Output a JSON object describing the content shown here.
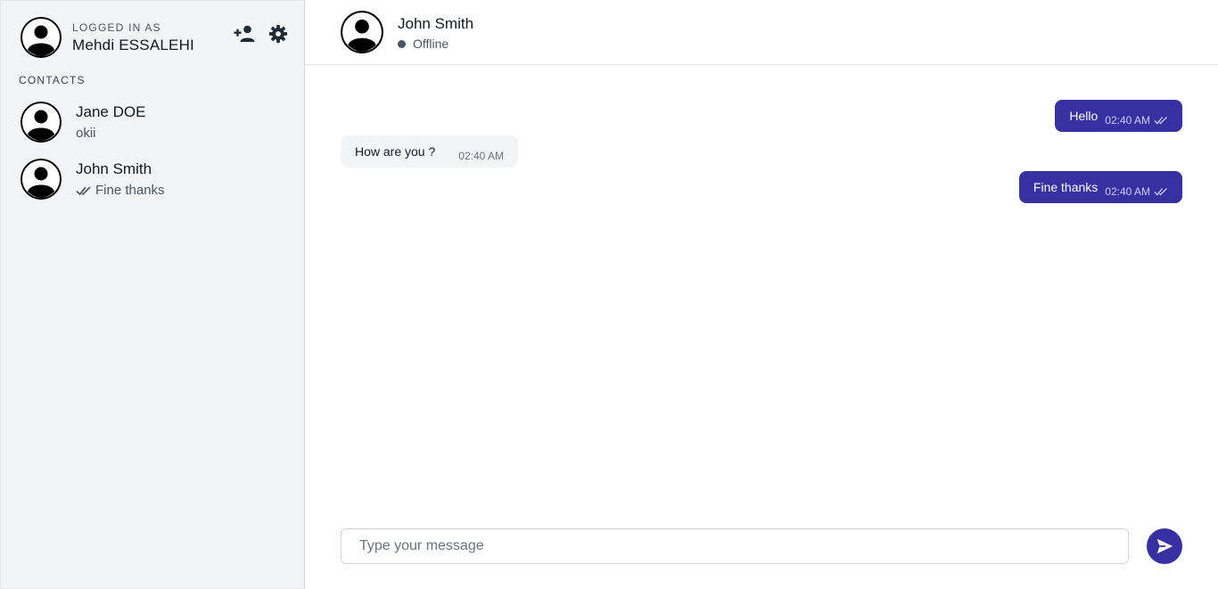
{
  "theme": {
    "accent": "#3730a3",
    "sidebar_bg": "#f3f4f6",
    "status_offline": "#4b5563"
  },
  "me": {
    "caption": "LOGGED IN AS",
    "name": "Mehdi ESSALEHI",
    "avatar_icon": "user-circle-icon"
  },
  "actions": {
    "add_contact_icon": "add-user-icon",
    "settings_icon": "gear-icon"
  },
  "contacts": {
    "title": "CONTACTS",
    "items": [
      {
        "name": "Jane DOE",
        "last_message": "okii",
        "read": false
      },
      {
        "name": "John Smith",
        "last_message": "Fine thanks",
        "read": true
      }
    ]
  },
  "chat": {
    "name": "John Smith",
    "status": "Offline",
    "messages": [
      {
        "direction": "out",
        "text": "Hello",
        "time": "02:40 AM",
        "read": true
      },
      {
        "direction": "in",
        "text": "How are you ?",
        "time": "02:40 AM"
      },
      {
        "direction": "out",
        "text": "Fine thanks",
        "time": "02:40 AM",
        "read": true
      }
    ]
  },
  "composer": {
    "placeholder": "Type your message",
    "value": "",
    "send_icon": "send-icon"
  }
}
